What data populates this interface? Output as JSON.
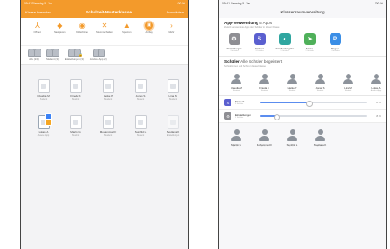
{
  "colors": {
    "accent": "#f39a2b",
    "blue": "#3b82f6"
  },
  "left": {
    "status": {
      "left": "09:41  Dienstag 5. Jan.",
      "right": "100 %"
    },
    "nav": {
      "left": "Klasse beenden",
      "title": "Schulzeit-Musterklasse",
      "right": "Auswählen"
    },
    "toolbar": [
      {
        "icon": "share-icon",
        "glyph": "⅄",
        "label": "Öffnen"
      },
      {
        "icon": "compass-icon",
        "glyph": "◆",
        "label": "Navigieren"
      },
      {
        "icon": "eye-icon",
        "glyph": "◉",
        "label": "Bildschirme"
      },
      {
        "icon": "mute-icon",
        "glyph": "✕",
        "label": "Stummschalten"
      },
      {
        "icon": "lock-icon",
        "glyph": "▲",
        "label": "Sperren"
      },
      {
        "icon": "apple-tv-icon",
        "glyph": "▣",
        "label": "AirPlay",
        "active": true
      },
      {
        "icon": "more-icon",
        "glyph": "›",
        "label": "Mehr"
      }
    ],
    "groups": [
      {
        "label": "Alle (13)"
      },
      {
        "label": "Student (3)"
      },
      {
        "label": "Einstellungen (3)"
      },
      {
        "label": "Andere App (2)"
      }
    ],
    "devices": [
      {
        "name": "Claudia M",
        "sub": "Student",
        "state": "normal"
      },
      {
        "name": "Frieda K",
        "sub": "Student",
        "state": "normal"
      },
      {
        "name": "Heike P",
        "sub": "Student",
        "state": "normal"
      },
      {
        "name": "Jonas S",
        "sub": "Student",
        "state": "normal"
      },
      {
        "name": "Lina M",
        "sub": "Student",
        "state": "normal"
      },
      {
        "name": "Lukas A",
        "sub": "Andere App",
        "state": "app"
      },
      {
        "name": "Martin G",
        "sub": "Student",
        "state": "normal"
      },
      {
        "name": "Mohammad F",
        "sub": "Student",
        "state": "normal"
      },
      {
        "name": "Sunhild L",
        "sub": "Student",
        "state": "normal"
      },
      {
        "name": "Svetlana K",
        "sub": "Einstellungen",
        "state": "dim"
      }
    ]
  },
  "right": {
    "status": {
      "left": "09:41  Dienstag 5. Jan.",
      "right": "100 %"
    },
    "nav": {
      "title": "Klassenraumverwaltung"
    },
    "apps_section": {
      "title": "App-Verwendung",
      "count": "5 Apps",
      "sub": "Zuletzt verwendete Apps der Schüler in dieser Klasse",
      "apps": [
        {
          "name": "Einstellungen",
          "sub": "1 Schüler",
          "glyph": "⚙",
          "color": "#8e8e93"
        },
        {
          "name": "Student",
          "sub": "3 Schüler",
          "glyph": "S",
          "color": "#5a5fcf"
        },
        {
          "name": "Familienfreigabe",
          "sub": "1 Schüler",
          "glyph": "◐",
          "color": "#2fa6a0"
        },
        {
          "name": "Karten",
          "sub": "1 Schüler",
          "glyph": "➤",
          "color": "#4fb05a"
        },
        {
          "name": "Pages",
          "sub": "1 Schüler",
          "glyph": "P",
          "color": "#3a8ee6"
        }
      ]
    },
    "students_section": {
      "title": "Schüler",
      "filter": "Alle Schüler begeistert",
      "sub": "Schülerinnen und Schüler dieser Klasse",
      "students": [
        {
          "name": "Claudia M",
          "sub": "Student"
        },
        {
          "name": "Frieda K",
          "sub": "Student"
        },
        {
          "name": "Heike P",
          "sub": "Student"
        },
        {
          "name": "Jonas S",
          "sub": "Student"
        },
        {
          "name": "Lina M",
          "sub": "Student"
        },
        {
          "name": "Lukas A",
          "sub": "Andere App"
        }
      ]
    },
    "controls": [
      {
        "title": "Student",
        "sub": "3 Schüler",
        "glyph": "S",
        "color": "#5a5fcf",
        "value": "45 %",
        "fill": 0.45
      },
      {
        "title": "Einstellungen",
        "sub": "1 Schüler",
        "glyph": "⚙",
        "color": "#8e8e93",
        "value": "15 %",
        "fill": 0.15
      }
    ],
    "students_bottom": [
      {
        "name": "Martin G",
        "sub": "Student"
      },
      {
        "name": "Mohammad F",
        "sub": "Student"
      },
      {
        "name": "Sunhild L",
        "sub": "Student"
      },
      {
        "name": "Svetlana K",
        "sub": "Student"
      }
    ]
  }
}
